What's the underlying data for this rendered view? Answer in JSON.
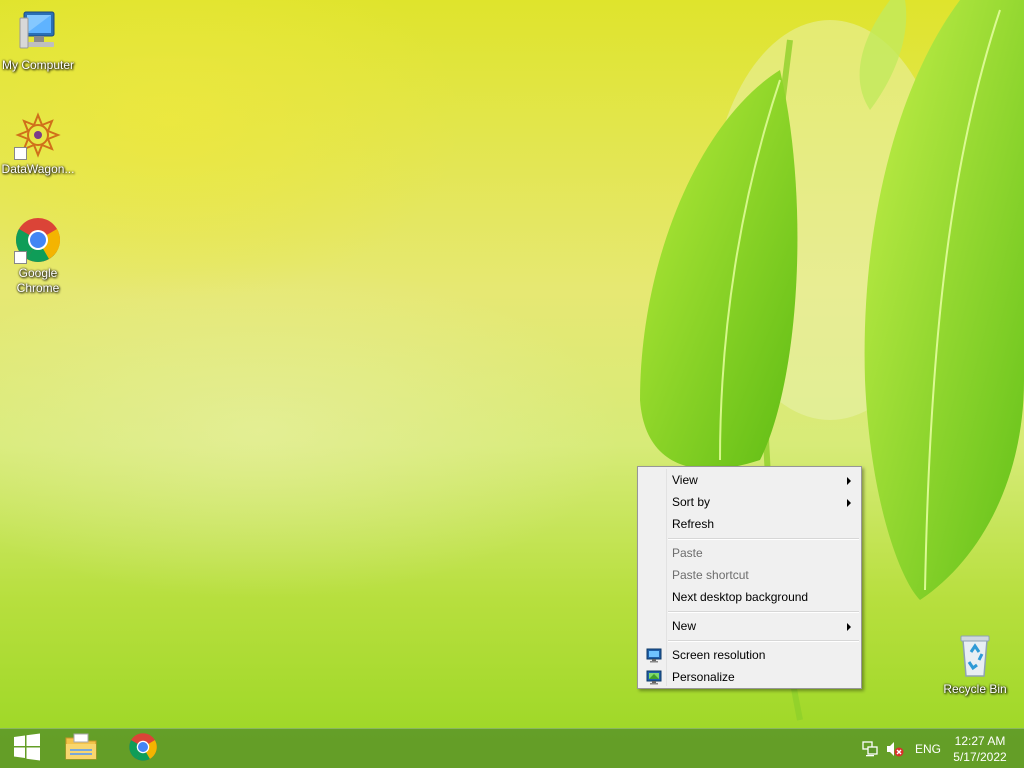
{
  "desktop": {
    "icons": [
      {
        "label": "My Computer",
        "icon": "computer-icon"
      },
      {
        "label": "DataWagon...",
        "icon": "datawagon-icon"
      },
      {
        "label": "Google Chrome",
        "label_line1": "Google",
        "label_line2": "Chrome",
        "icon": "chrome-icon"
      },
      {
        "label": "Recycle Bin",
        "icon": "recycle-bin-icon"
      }
    ]
  },
  "context_menu": {
    "items": [
      {
        "label": "View",
        "submenu": true,
        "enabled": true
      },
      {
        "label": "Sort by",
        "submenu": true,
        "enabled": true
      },
      {
        "label": "Refresh",
        "submenu": false,
        "enabled": true
      },
      {
        "label": "Paste",
        "submenu": false,
        "enabled": false
      },
      {
        "label": "Paste shortcut",
        "submenu": false,
        "enabled": false
      },
      {
        "label": "Next desktop background",
        "submenu": false,
        "enabled": true
      },
      {
        "label": "New",
        "submenu": true,
        "enabled": true
      },
      {
        "label": "Screen resolution",
        "submenu": false,
        "enabled": true,
        "icon": "screen-resolution-icon"
      },
      {
        "label": "Personalize",
        "submenu": false,
        "enabled": true,
        "icon": "personalize-icon"
      }
    ]
  },
  "taskbar": {
    "start_icon": "windows-logo-icon",
    "pinned": [
      "file-explorer-icon",
      "chrome-icon"
    ],
    "tray": {
      "language": "ENG",
      "time": "12:27 AM",
      "date": "5/17/2022",
      "icons": [
        "network-icon",
        "volume-muted-icon"
      ]
    }
  },
  "colors": {
    "menu_bg": "#f0f0f0",
    "taskbar": "#5c9628",
    "wallpaper_top": "#dfe42c",
    "wallpaper_bottom": "#99d622"
  }
}
